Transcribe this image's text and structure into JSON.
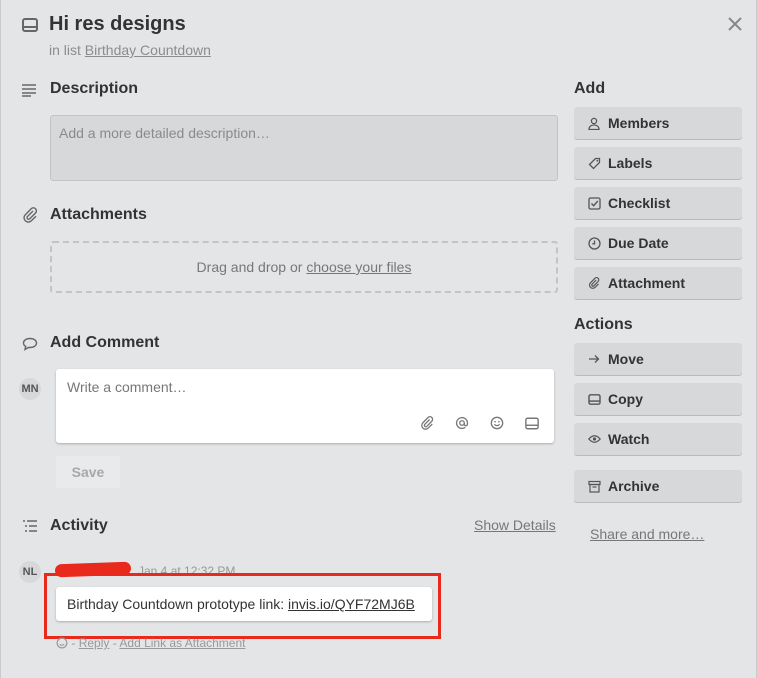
{
  "card": {
    "title": "Hi res designs",
    "list_prefix": "in list",
    "list_name": "Birthday Countdown"
  },
  "description": {
    "heading": "Description",
    "placeholder": "Add a more detailed description…"
  },
  "attachments": {
    "heading": "Attachments",
    "drop_text": "Drag and drop or",
    "choose_link": "choose your files"
  },
  "comment": {
    "heading": "Add Comment",
    "avatar_initials": "MN",
    "placeholder": "Write a comment…",
    "save_label": "Save"
  },
  "activity": {
    "heading": "Activity",
    "show_details": "Show Details",
    "entry": {
      "avatar_initials": "NL",
      "timestamp": "Jan 4 at 12:32 PM",
      "text": "Birthday Countdown prototype link:",
      "link": "invis.io/QYF72MJ6B",
      "sep": "-",
      "reply": "Reply",
      "add_attachment": "Add Link as Attachment"
    }
  },
  "sidebar": {
    "add_heading": "Add",
    "add_buttons": [
      {
        "label": "Members",
        "icon": "person-icon"
      },
      {
        "label": "Labels",
        "icon": "tag-icon"
      },
      {
        "label": "Checklist",
        "icon": "checkbox-icon"
      },
      {
        "label": "Due Date",
        "icon": "clock-icon"
      },
      {
        "label": "Attachment",
        "icon": "paperclip-icon"
      }
    ],
    "actions_heading": "Actions",
    "action_buttons": [
      {
        "label": "Move",
        "icon": "arrow-right-icon"
      },
      {
        "label": "Copy",
        "icon": "card-icon"
      },
      {
        "label": "Watch",
        "icon": "eye-icon"
      },
      {
        "label": "Archive",
        "icon": "archive-icon"
      }
    ],
    "share_more": "Share and more…"
  },
  "colors": {
    "background": "#e4e5e7",
    "button": "#d6d8da",
    "highlight": "#e8291c"
  }
}
